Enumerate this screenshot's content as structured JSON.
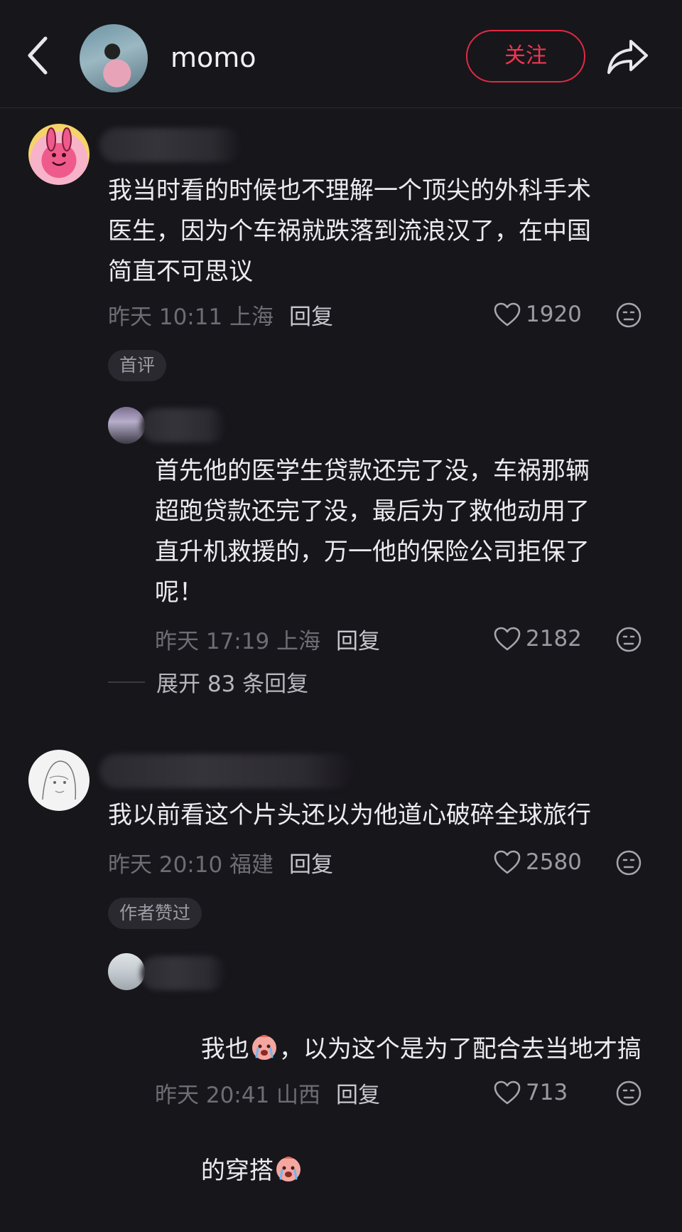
{
  "header": {
    "username": "momo",
    "follow_label": "关注"
  },
  "comments": [
    {
      "text": "我当时看的时候也不理解一个顶尖的外科手术\n医生，因为个车祸就跌落到流浪汉了，在中国\n简直不可思议",
      "time": "昨天 10:11 上海",
      "reply_label": "回复",
      "likes": "1920",
      "tag": "首评",
      "replies": [
        {
          "text": "首先他的医学生贷款还完了没，车祸那辆\n超跑贷款还完了没，最后为了救他动用了\n直升机救援的，万一他的保险公司拒保了\n呢！",
          "time": "昨天 17:19 上海",
          "reply_label": "回复",
          "likes": "2182"
        }
      ],
      "expand_label": "展开 83 条回复"
    },
    {
      "text": "我以前看这个片头还以为他道心破碎全球旅行",
      "time": "昨天 20:10 福建",
      "reply_label": "回复",
      "likes": "2580",
      "tag": "作者赞过",
      "replies": [
        {
          "text_part1": "我也",
          "text_part2": "，以为这个是为了配合去当地才搞",
          "text_part3": "的穿搭",
          "time": "昨天 20:41 山西",
          "reply_label": "回复",
          "likes": "713"
        }
      ]
    }
  ],
  "colors": {
    "background": "#17161b",
    "follow_red": "#e12a42",
    "meta_gray": "#6e6d75"
  }
}
